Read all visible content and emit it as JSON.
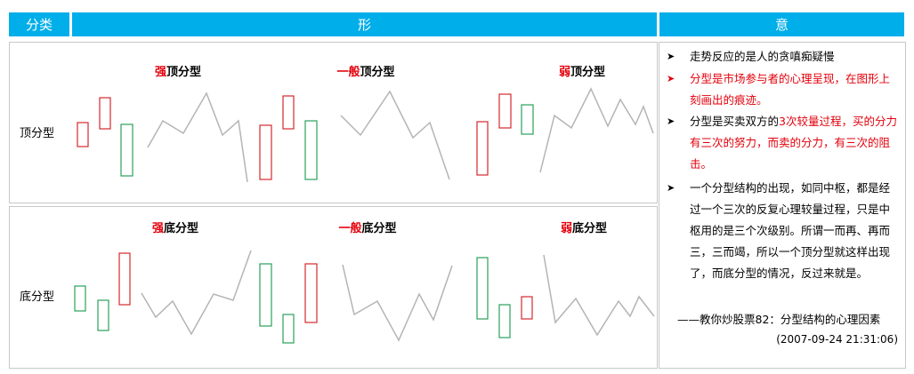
{
  "header": {
    "col1": "分类",
    "col2": "形",
    "col3": "意"
  },
  "rows": [
    {
      "label": "顶分型",
      "patterns": [
        {
          "prefix": "强",
          "suffix": "顶分型"
        },
        {
          "prefix": "一般",
          "suffix": "顶分型"
        },
        {
          "prefix": "弱",
          "suffix": "顶分型"
        }
      ]
    },
    {
      "label": "底分型",
      "patterns": [
        {
          "prefix": "强",
          "suffix": "底分型"
        },
        {
          "prefix": "一般",
          "suffix": "底分型"
        },
        {
          "prefix": "弱",
          "suffix": "底分型"
        }
      ]
    }
  ],
  "meaning": {
    "b1": "走势反应的是人的贪嗔痴疑慢",
    "b2": "分型是市场参与者的心理呈现，在图形上刻画出的痕迹。",
    "b3_pre": "分型是买卖双方的",
    "b3_hl": "3次较量过程，买的分力有三次的努力，而卖的分力，有三次的阻击。",
    "b4": "一个分型结构的出现，如同中枢，都是经过一个三次的反复心理较量过程，只是中枢用的是三个次级别。所谓一而再、再而三，三而竭，所以一个顶分型就这样出现了，而底分型的情况，反过来就是。",
    "source": "——教你炒股票82：分型结构的心理因素",
    "timestamp": "(2007-09-24 21:31:06)"
  },
  "colors": {
    "header_bg": "#00aeea",
    "up_candle": "#d6282d",
    "down_candle": "#2aa05a",
    "line": "#b4b4b4",
    "highlight": "#e3000b"
  }
}
